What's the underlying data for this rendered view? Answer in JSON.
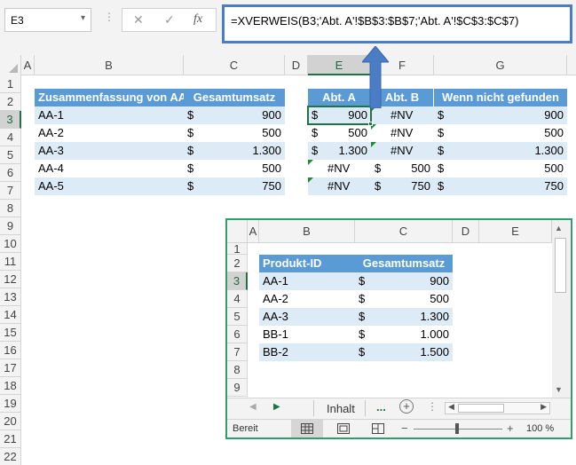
{
  "namebox": "E3",
  "formula_buttons": {
    "cancel": "✕",
    "enter": "✓",
    "fx": "fx"
  },
  "formula": "=XVERWEIS(B3;'Abt. A'!$B$3:$B$7;'Abt. A'!$C$3:$C$7)",
  "columns": [
    "A",
    "B",
    "C",
    "D",
    "E",
    "F",
    "G"
  ],
  "rows": [
    "1",
    "2",
    "3",
    "4",
    "5",
    "6",
    "7",
    "8",
    "9",
    "10",
    "11",
    "12",
    "13",
    "14",
    "15",
    "16",
    "17",
    "18",
    "19",
    "20",
    "21",
    "22"
  ],
  "summary": {
    "headers": [
      "Zusammenfassung von AA",
      "Gesamtumsatz"
    ],
    "rows": [
      {
        "id": "AA-1",
        "cur": "$",
        "val": "900"
      },
      {
        "id": "AA-2",
        "cur": "$",
        "val": "500"
      },
      {
        "id": "AA-3",
        "cur": "$",
        "val": "1.300"
      },
      {
        "id": "AA-4",
        "cur": "$",
        "val": "500"
      },
      {
        "id": "AA-5",
        "cur": "$",
        "val": "750"
      }
    ]
  },
  "lookup": {
    "headers": [
      "Abt. A",
      "Abt. B",
      "Wenn nicht gefunden"
    ],
    "rows": [
      {
        "a_cur": "$",
        "a": "900",
        "b_cur": "",
        "b": "#NV",
        "g_cur": "$",
        "g": "900"
      },
      {
        "a_cur": "$",
        "a": "500",
        "b_cur": "",
        "b": "#NV",
        "g_cur": "$",
        "g": "500"
      },
      {
        "a_cur": "$",
        "a": "1.300",
        "b_cur": "",
        "b": "#NV",
        "g_cur": "$",
        "g": "1.300"
      },
      {
        "a_cur": "",
        "a": "#NV",
        "b_cur": "$",
        "b": "500",
        "g_cur": "$",
        "g": "500"
      },
      {
        "a_cur": "",
        "a": "#NV",
        "b_cur": "$",
        "b": "750",
        "g_cur": "$",
        "g": "750"
      }
    ]
  },
  "window": {
    "columns": [
      "A",
      "B",
      "C",
      "D",
      "E"
    ],
    "rows": [
      "1",
      "2",
      "3",
      "4",
      "5",
      "6",
      "7",
      "8",
      "9"
    ],
    "headers": [
      "Produkt-ID",
      "Gesamtumsatz"
    ],
    "data": [
      {
        "id": "AA-1",
        "cur": "$",
        "val": "900"
      },
      {
        "id": "AA-2",
        "cur": "$",
        "val": "500"
      },
      {
        "id": "AA-3",
        "cur": "$",
        "val": "1.300"
      },
      {
        "id": "BB-1",
        "cur": "$",
        "val": "1.000"
      },
      {
        "id": "BB-2",
        "cur": "$",
        "val": "1.500"
      }
    ],
    "sheet_tab": "Inhalt",
    "more": "...",
    "status": "Bereit",
    "zoom": "100 %",
    "zoom_minus": "−",
    "zoom_plus": "+"
  },
  "icons": [
    "chevron-down-icon",
    "cancel-icon",
    "enter-icon",
    "fx-icon",
    "arrow-up-icon",
    "prev-sheet-icon",
    "next-sheet-icon",
    "add-sheet-icon",
    "normal-view-icon",
    "page-layout-icon",
    "page-break-icon"
  ],
  "colors": {
    "header": "#5b9bd5",
    "band": "#ddebf7",
    "excel_green": "#217346",
    "arrow": "#4a7dc6",
    "window_border": "#2f9e6f"
  }
}
